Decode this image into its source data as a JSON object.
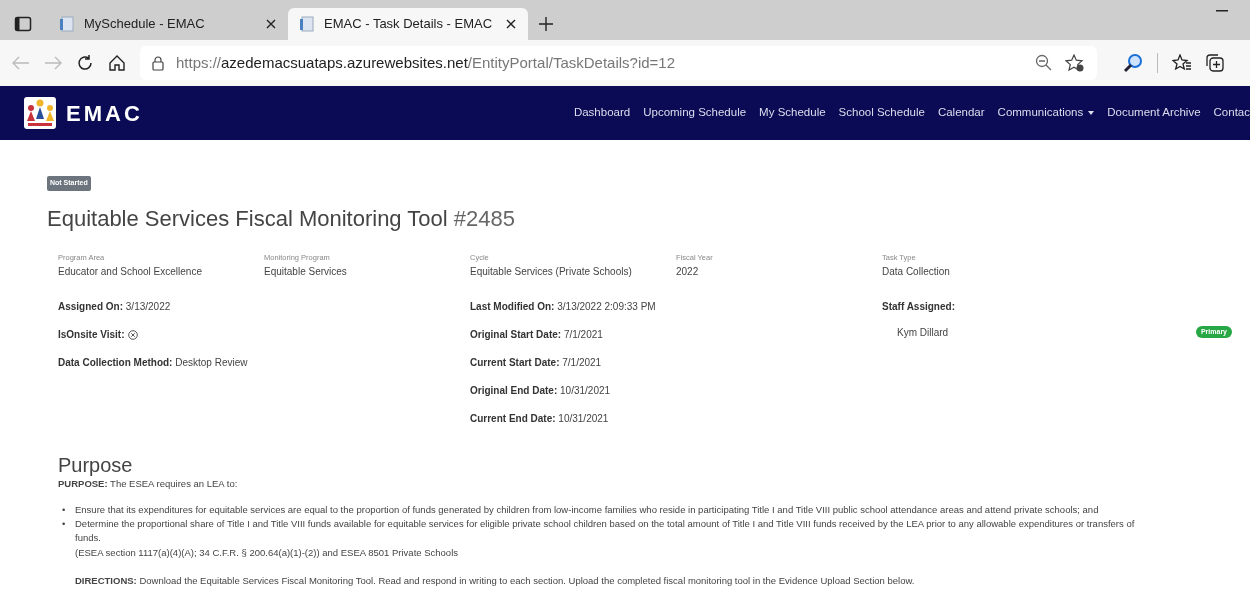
{
  "browser": {
    "tabs": [
      {
        "title": "MySchedule - EMAC",
        "selected": false
      },
      {
        "title": "EMAC - Task Details - EMAC",
        "selected": true
      }
    ],
    "url": {
      "scheme": "https://",
      "host": "azedemacsuataps.azurewebsites.net",
      "path": "/EntityPortal/TaskDetails?id=12"
    }
  },
  "navbar": {
    "brand": "EMAC",
    "items": [
      {
        "label": "Dashboard",
        "dropdown": false
      },
      {
        "label": "Upcoming Schedule",
        "dropdown": false
      },
      {
        "label": "My Schedule",
        "dropdown": false
      },
      {
        "label": "School Schedule",
        "dropdown": false
      },
      {
        "label": "Calendar",
        "dropdown": false
      },
      {
        "label": "Communications",
        "dropdown": true
      },
      {
        "label": "Document Archive",
        "dropdown": false
      },
      {
        "label": "Contac",
        "dropdown": false
      }
    ]
  },
  "status_badge": "Not Started",
  "title": {
    "text": "Equitable Services Fiscal Monitoring Tool",
    "number": "#2485"
  },
  "summary": [
    {
      "label": "Program Area",
      "value": "Educator and School Excellence"
    },
    {
      "label": "Monitoring Program",
      "value": "Equitable Services"
    },
    {
      "label": "Cycle",
      "value": "Equitable Services (Private Schools)"
    },
    {
      "label": "Fiscal Year",
      "value": "2022"
    },
    {
      "label": "Task Type",
      "value": "Data Collection"
    }
  ],
  "details_left": [
    {
      "kind": "text",
      "label": "Assigned On:",
      "value": "3/13/2022"
    },
    {
      "kind": "flag",
      "label": "IsOnsite Visit:",
      "checked": false
    },
    {
      "kind": "text",
      "label": "Data Collection Method:",
      "value": "Desktop Review"
    }
  ],
  "details_middle": [
    {
      "label": "Last Modified On:",
      "value": "3/13/2022 2:09:33 PM"
    },
    {
      "label": "Original Start Date:",
      "value": "7/1/2021"
    },
    {
      "label": "Current Start Date:",
      "value": "7/1/2021"
    },
    {
      "label": "Original End Date:",
      "value": "10/31/2021"
    },
    {
      "label": "Current End Date:",
      "value": "10/31/2021"
    }
  ],
  "staff": {
    "heading": "Staff Assigned:",
    "members": [
      {
        "name": "Kym Dillard",
        "role": "Primary"
      }
    ]
  },
  "purpose": {
    "heading": "Purpose",
    "intro": "**PURPOSE:** The ESEA requires an LEA to:",
    "bullets": [
      {
        "marker": "•",
        "text": "Ensure that its expenditures for equitable services are equal to the proportion of funds generated by children from low-income families who reside in participating Title I and Title VIII public school attendance areas and attend private schools; and"
      },
      {
        "marker": "•",
        "text": "Determine the proportional share of Title I and Title VIII funds available for equitable services for eligible private school children based on the total amount of Title I and Title VIII funds received by the LEA prior to any allowable expenditures or transfers of funds."
      }
    ],
    "citation": "(ESEA section 1117(a)(4)(A); 34 C.F.R. § 200.64(a)(1)-(2)) and ESEA 8501 Private Schools",
    "directions": "**DIRECTIONS:** Download the Equitable Services Fiscal Monitoring Tool. Read and respond in writing to each section. Upload the completed fiscal monitoring tool in the Evidence Upload Section below."
  }
}
